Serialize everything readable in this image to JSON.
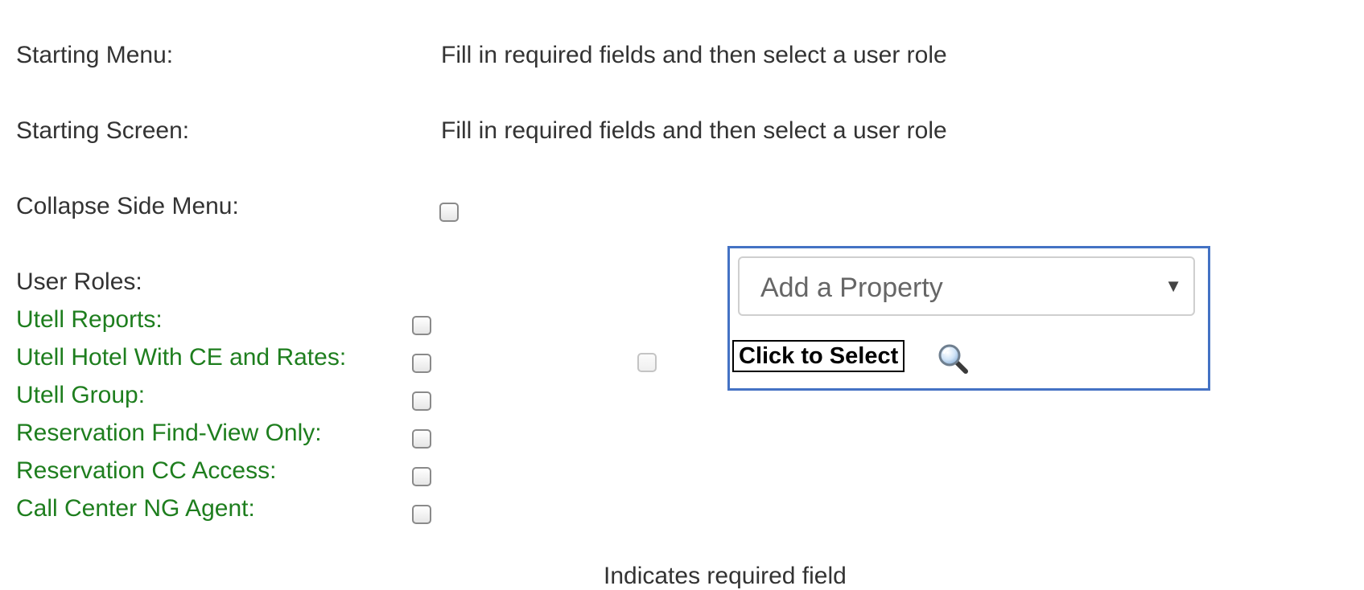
{
  "settings": {
    "starting_menu_label": "Starting Menu:",
    "starting_menu_value": "Fill in required fields and then select a user role",
    "starting_screen_label": "Starting Screen:",
    "starting_screen_value": "Fill in required fields and then select a user role",
    "collapse_side_menu_label": "Collapse Side Menu:"
  },
  "user_roles": {
    "heading": "User Roles:",
    "roles": [
      {
        "label": "Utell Reports:"
      },
      {
        "label": "Utell Hotel With CE and Rates:"
      },
      {
        "label": "Utell Group:"
      },
      {
        "label": "Reservation Find-View Only:"
      },
      {
        "label": "Reservation CC Access:"
      },
      {
        "label": "Call Center NG Agent:"
      }
    ]
  },
  "property_picker": {
    "select_placeholder": "Add a Property",
    "click_to_select_label": "Click to Select",
    "icon": "magnifier-icon",
    "border_color": "#4472c4"
  },
  "footer": {
    "partial_text": "Indicates required field"
  },
  "colors": {
    "role_label": "#1e7e1e",
    "text": "#333333"
  }
}
